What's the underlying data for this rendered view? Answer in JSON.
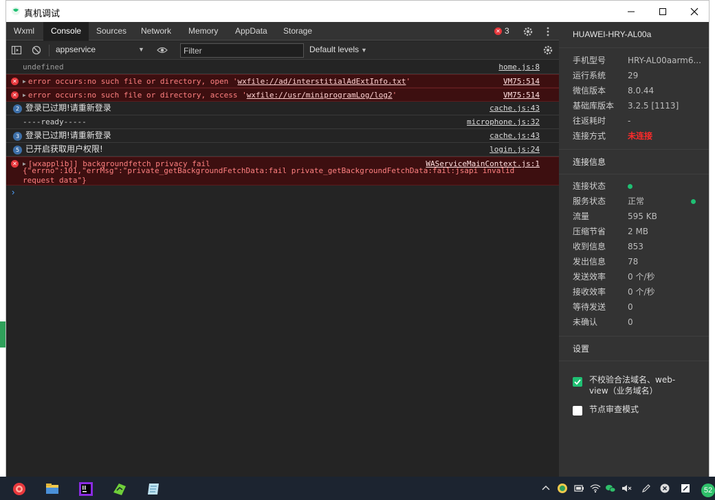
{
  "window": {
    "title": "真机调试"
  },
  "tabs": [
    {
      "label": "Wxml",
      "active": false
    },
    {
      "label": "Console",
      "active": true
    },
    {
      "label": "Sources",
      "active": false
    },
    {
      "label": "Network",
      "active": false
    },
    {
      "label": "Memory",
      "active": false
    },
    {
      "label": "AppData",
      "active": false
    },
    {
      "label": "Storage",
      "active": false
    }
  ],
  "error_count": "3",
  "toolbar": {
    "context": "appservice",
    "filter_placeholder": "Filter",
    "levels": "Default levels"
  },
  "console": {
    "rows": [
      {
        "type": "log",
        "message": "undefined",
        "source": "home.js:8"
      },
      {
        "type": "error",
        "prefix": "error occurs:no such file or directory, open '",
        "link": "wxfile://ad/interstitialAdExtInfo.txt",
        "suffix": "'",
        "source": "VM75:514"
      },
      {
        "type": "error",
        "prefix": "error occurs:no such file or directory, access '",
        "link": "wxfile://usr/miniprogramLog/log2",
        "suffix": "'",
        "source": "VM75:514"
      },
      {
        "type": "info",
        "count": "2",
        "message": "登录已过期!请重新登录",
        "source": "cache.js:43"
      },
      {
        "type": "log",
        "message": "----ready-----",
        "source": "microphone.js:32"
      },
      {
        "type": "info",
        "count": "3",
        "message": "登录已过期!请重新登录",
        "source": "cache.js:43"
      },
      {
        "type": "info",
        "count": "5",
        "message": "已开启获取用户权限!",
        "source": "login.js:24"
      },
      {
        "type": "error",
        "message": "[wxapplib]] backgroundfetch privacy fail",
        "detail": "{\"errno\":101,\"errMsg\":\"private_getBackgroundFetchData:fail private_getBackgroundFetchData:fail:jsapi invalid\nrequest data\"}",
        "source": "WAServiceMainContext.js:1"
      }
    ],
    "prompt": "›"
  },
  "panel": {
    "device": "HUAWEI-HRY-AL00a",
    "info": [
      {
        "key": "手机型号",
        "value": "HRY-AL00aarm6..."
      },
      {
        "key": "运行系统",
        "value": "29"
      },
      {
        "key": "微信版本",
        "value": "8.0.44"
      },
      {
        "key": "基础库版本",
        "value": "3.2.5 [1113]"
      },
      {
        "key": "往返耗时",
        "value": "-"
      },
      {
        "key": "连接方式",
        "value": "未连接"
      }
    ],
    "conn_title": "连接信息",
    "conn": [
      {
        "key": "连接状态",
        "value": ""
      },
      {
        "key": "服务状态",
        "value": "正常"
      },
      {
        "key": "流量",
        "value": "595 KB"
      },
      {
        "key": "压缩节省",
        "value": "2 MB"
      },
      {
        "key": "收到信息",
        "value": "853"
      },
      {
        "key": "发出信息",
        "value": "78"
      },
      {
        "key": "发送效率",
        "value": "0 个/秒"
      },
      {
        "key": "接收效率",
        "value": "0 个/秒"
      },
      {
        "key": "等待发送",
        "value": "0"
      },
      {
        "key": "未确认",
        "value": "0"
      }
    ],
    "settings_title": "设置",
    "settings": [
      {
        "label": "不校验合法域名、web-view（业务域名）",
        "checked": true
      },
      {
        "label": "节点审查模式",
        "checked": false
      }
    ]
  },
  "taskbar": {
    "badge": "52"
  },
  "colors": {
    "accent": "#1fc073",
    "error": "#e8383d",
    "error_bg": "#3d0f10",
    "panel_bg": "#333333"
  }
}
